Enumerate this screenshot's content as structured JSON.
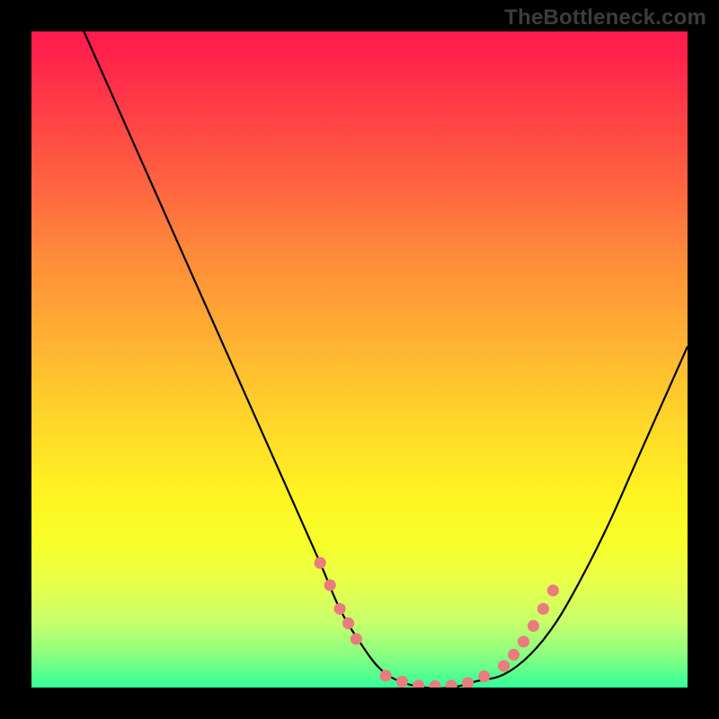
{
  "watermark": "TheBottleneck.com",
  "chart_data": {
    "type": "line",
    "title": "",
    "xlabel": "",
    "ylabel": "",
    "xlim": [
      0,
      100
    ],
    "ylim": [
      0,
      100
    ],
    "grid": false,
    "series": [
      {
        "name": "curve",
        "color": "#000000",
        "x": [
          8,
          12,
          16,
          20,
          24,
          28,
          32,
          36,
          40,
          44,
          47,
          50,
          53,
          56,
          60,
          64,
          68,
          72,
          76,
          80,
          84,
          88,
          92,
          96,
          100
        ],
        "y": [
          100,
          91,
          82,
          73,
          64,
          55,
          46,
          37,
          28,
          19,
          12,
          7,
          3,
          1,
          0,
          0,
          1,
          2,
          5,
          10,
          17,
          25,
          34,
          43,
          52
        ]
      }
    ],
    "markers": {
      "name": "dots",
      "color": "#e97c7c",
      "radius_pct": 0.9,
      "points": [
        {
          "x": 44.0,
          "y": 19.0
        },
        {
          "x": 45.5,
          "y": 15.6
        },
        {
          "x": 47.0,
          "y": 12.0
        },
        {
          "x": 48.3,
          "y": 9.8
        },
        {
          "x": 49.5,
          "y": 7.4
        },
        {
          "x": 54.0,
          "y": 1.8
        },
        {
          "x": 56.5,
          "y": 0.9
        },
        {
          "x": 59.0,
          "y": 0.3
        },
        {
          "x": 61.5,
          "y": 0.2
        },
        {
          "x": 64.0,
          "y": 0.3
        },
        {
          "x": 66.5,
          "y": 0.7
        },
        {
          "x": 69.0,
          "y": 1.7
        },
        {
          "x": 72.0,
          "y": 3.3
        },
        {
          "x": 73.5,
          "y": 5.0
        },
        {
          "x": 75.0,
          "y": 7.0
        },
        {
          "x": 76.5,
          "y": 9.4
        },
        {
          "x": 78.0,
          "y": 12.0
        },
        {
          "x": 79.5,
          "y": 14.8
        }
      ]
    },
    "background_gradient": {
      "top": "#ff1a4d",
      "bottom": "#33ff99"
    }
  }
}
